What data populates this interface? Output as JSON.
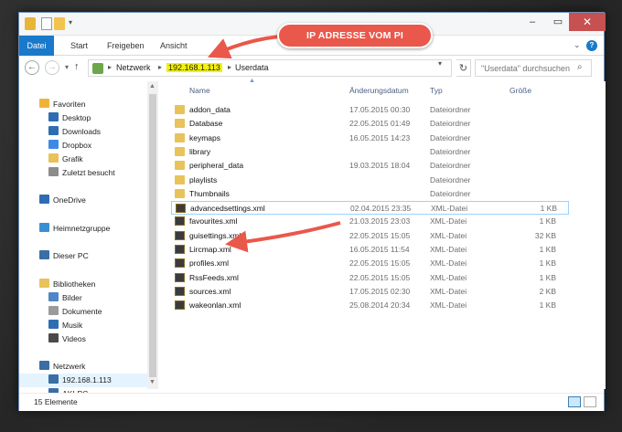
{
  "ribbon": {
    "file": "Datei",
    "tabs": [
      "Start",
      "Freigeben",
      "Ansicht"
    ]
  },
  "address": {
    "crumbs": [
      "Netzwerk",
      "192.168.1.113",
      "Userdata"
    ],
    "highlighted": "192.168.1.113"
  },
  "search": {
    "placeholder": "\"Userdata\" durchsuchen"
  },
  "nav": {
    "items": [
      {
        "label": "Favoriten",
        "icon": "star-icon",
        "color": "#f0b33a"
      },
      {
        "label": "Desktop",
        "icon": "desktop-icon",
        "color": "#2f6db3"
      },
      {
        "label": "Downloads",
        "icon": "download-icon",
        "color": "#2f6db3"
      },
      {
        "label": "Dropbox",
        "icon": "dropbox-icon",
        "color": "#3d8ae6"
      },
      {
        "label": "Grafik",
        "icon": "folder-icon",
        "color": "#e8c25a"
      },
      {
        "label": "Zuletzt besucht",
        "icon": "recent-icon",
        "color": "#8c8c8c"
      },
      {
        "label": "OneDrive",
        "icon": "cloud-icon",
        "color": "#2f6db3"
      },
      {
        "label": "Heimnetzgruppe",
        "icon": "homegroup-icon",
        "color": "#3a8fd4"
      },
      {
        "label": "Dieser PC",
        "icon": "computer-icon",
        "color": "#3a6ea5"
      },
      {
        "label": "Bibliotheken",
        "icon": "library-icon",
        "color": "#e8c25a"
      },
      {
        "label": "Bilder",
        "icon": "pictures-icon",
        "color": "#4f86c6"
      },
      {
        "label": "Dokumente",
        "icon": "documents-icon",
        "color": "#9b9b9b"
      },
      {
        "label": "Musik",
        "icon": "music-icon",
        "color": "#2f6db3"
      },
      {
        "label": "Videos",
        "icon": "video-icon",
        "color": "#4a4a4a"
      },
      {
        "label": "Netzwerk",
        "icon": "network-icon",
        "color": "#3a6ea5"
      },
      {
        "label": "192.168.1.113",
        "icon": "computer-icon",
        "color": "#3a6ea5"
      },
      {
        "label": "AKI-PC",
        "icon": "computer-icon",
        "color": "#3a6ea5"
      }
    ]
  },
  "columns": {
    "name": "Name",
    "date": "Änderungsdatum",
    "type": "Typ",
    "size": "Größe"
  },
  "files": [
    {
      "name": "addon_data",
      "date": "17.05.2015 00:30",
      "type": "Dateiordner",
      "size": "",
      "kind": "folder"
    },
    {
      "name": "Database",
      "date": "22.05.2015 01:49",
      "type": "Dateiordner",
      "size": "",
      "kind": "folder"
    },
    {
      "name": "keymaps",
      "date": "16.05.2015 14:23",
      "type": "Dateiordner",
      "size": "",
      "kind": "folder"
    },
    {
      "name": "library",
      "date": "",
      "type": "Dateiordner",
      "size": "",
      "kind": "folder"
    },
    {
      "name": "peripheral_data",
      "date": "19.03.2015 18:04",
      "type": "Dateiordner",
      "size": "",
      "kind": "folder"
    },
    {
      "name": "playlists",
      "date": "",
      "type": "Dateiordner",
      "size": "",
      "kind": "folder"
    },
    {
      "name": "Thumbnails",
      "date": "",
      "type": "Dateiordner",
      "size": "",
      "kind": "folder"
    },
    {
      "name": "advancedsettings.xml",
      "date": "02.04.2015 23:35",
      "type": "XML-Datei",
      "size": "1 KB",
      "kind": "xml"
    },
    {
      "name": "favourites.xml",
      "date": "21.03.2015 23:03",
      "type": "XML-Datei",
      "size": "1 KB",
      "kind": "xml"
    },
    {
      "name": "guisettings.xml",
      "date": "22.05.2015 15:05",
      "type": "XML-Datei",
      "size": "32 KB",
      "kind": "xml"
    },
    {
      "name": "Lircmap.xml",
      "date": "16.05.2015 11:54",
      "type": "XML-Datei",
      "size": "1 KB",
      "kind": "xml"
    },
    {
      "name": "profiles.xml",
      "date": "22.05.2015 15:05",
      "type": "XML-Datei",
      "size": "1 KB",
      "kind": "xml"
    },
    {
      "name": "RssFeeds.xml",
      "date": "22.05.2015 15:05",
      "type": "XML-Datei",
      "size": "1 KB",
      "kind": "xml"
    },
    {
      "name": "sources.xml",
      "date": "17.05.2015 02:30",
      "type": "XML-Datei",
      "size": "2 KB",
      "kind": "xml"
    },
    {
      "name": "wakeonlan.xml",
      "date": "25.08.2014 20:34",
      "type": "XML-Datei",
      "size": "1 KB",
      "kind": "xml"
    }
  ],
  "selected_file": "advancedsettings.xml",
  "status": {
    "count": "15 Elemente"
  },
  "annotation": {
    "callout": "IP ADRESSE VOM PI",
    "color": "#e9584a"
  }
}
